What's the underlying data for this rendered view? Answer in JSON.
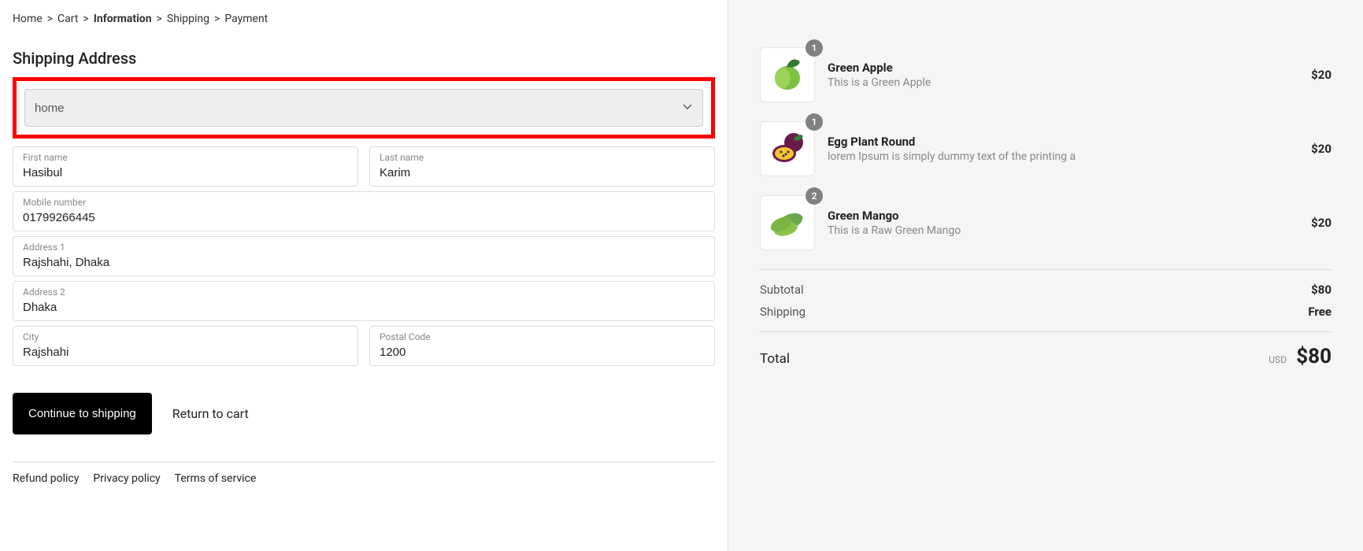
{
  "breadcrumb": [
    "Home",
    "Cart",
    "Information",
    "Shipping",
    "Payment"
  ],
  "breadcrumb_sep": ">",
  "breadcrumb_current_index": 2,
  "heading": "Shipping Address",
  "saved_address": {
    "value": "home"
  },
  "fields": {
    "first_name": {
      "label": "First name",
      "value": "Hasibul"
    },
    "last_name": {
      "label": "Last name",
      "value": "Karim"
    },
    "mobile": {
      "label": "Mobile number",
      "value": "01799266445"
    },
    "address1": {
      "label": "Address 1",
      "value": "Rajshahi, Dhaka"
    },
    "address2": {
      "label": "Address 2",
      "value": "Dhaka"
    },
    "city": {
      "label": "City",
      "value": "Rajshahi"
    },
    "postal": {
      "label": "Postal Code",
      "value": "1200"
    }
  },
  "actions": {
    "continue": "Continue to shipping",
    "return": "Return to cart"
  },
  "footer": [
    "Refund policy",
    "Privacy policy",
    "Terms of service"
  ],
  "cart": {
    "items": [
      {
        "qty": "1",
        "title": "Green Apple",
        "desc": "This is a Green Apple",
        "price": "$20",
        "kind": "apple"
      },
      {
        "qty": "1",
        "title": "Egg Plant Round",
        "desc": "lorem Ipsum is simply dummy text of the printing a",
        "price": "$20",
        "kind": "passionfruit"
      },
      {
        "qty": "2",
        "title": "Green Mango",
        "desc": "This is a Raw Green Mango",
        "price": "$20",
        "kind": "mango"
      }
    ],
    "subtotal": {
      "label": "Subtotal",
      "value": "$80"
    },
    "shipping": {
      "label": "Shipping",
      "value": "Free"
    },
    "total": {
      "label": "Total",
      "currency": "USD",
      "value": "$80"
    }
  }
}
